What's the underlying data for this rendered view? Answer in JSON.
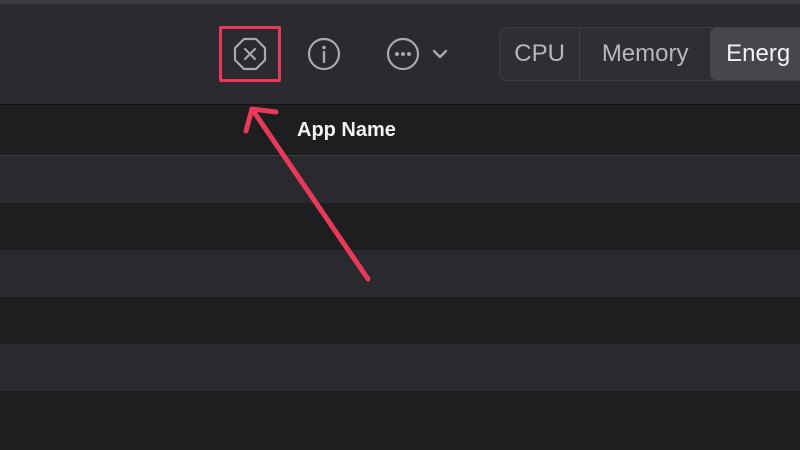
{
  "toolbar": {
    "stop_icon": "stop-process-octagon-x-icon",
    "info_icon": "info-circle-icon",
    "more_icon": "ellipsis-circle-icon",
    "chevron_icon": "chevron-down-icon",
    "tabs": [
      {
        "label": "CPU",
        "selected": false
      },
      {
        "label": "Memory",
        "selected": false
      },
      {
        "label": "Energ",
        "selected": true
      }
    ]
  },
  "table": {
    "columns": [
      {
        "label": "App Name"
      }
    ],
    "visible_rows": 6
  },
  "annotation": {
    "highlight_color": "#e8395a",
    "arrow_icon": "annotation-arrow"
  }
}
